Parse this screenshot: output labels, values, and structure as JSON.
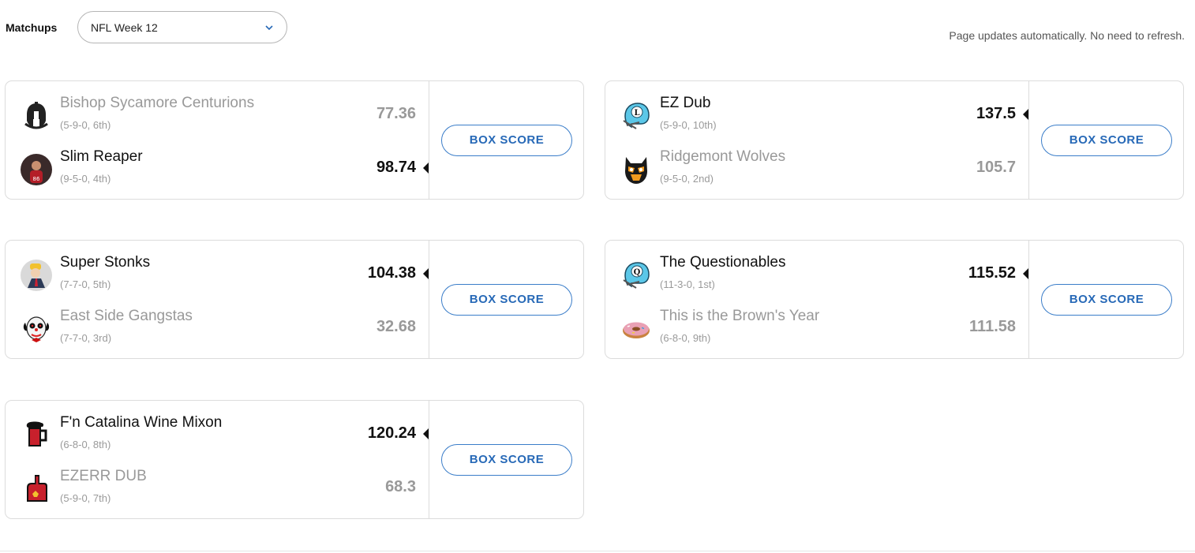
{
  "header": {
    "label": "Matchups",
    "week_select": {
      "value": "NFL Week 12"
    },
    "update_note": "Page updates automatically. No need to refresh."
  },
  "matchups": [
    {
      "box_score_label": "BOX SCORE",
      "teams": [
        {
          "name": "Bishop Sycamore Centurions",
          "record": "(5-9-0, 6th)",
          "score": "77.36",
          "winner": false,
          "icon": "spartan-helmet-icon"
        },
        {
          "name": "Slim Reaper",
          "record": "(9-5-0, 4th)",
          "score": "98.74",
          "winner": true,
          "icon": "player-photo-avatar"
        }
      ]
    },
    {
      "box_score_label": "BOX SCORE",
      "teams": [
        {
          "name": "EZ Dub",
          "record": "(5-9-0, 10th)",
          "score": "137.5",
          "winner": true,
          "icon": "football-helmet-l-icon"
        },
        {
          "name": "Ridgemont Wolves",
          "record": "(9-5-0, 2nd)",
          "score": "105.7",
          "winner": false,
          "icon": "wolf-mask-icon"
        }
      ]
    },
    {
      "box_score_label": "BOX SCORE",
      "teams": [
        {
          "name": "Super Stonks",
          "record": "(7-7-0, 5th)",
          "score": "104.38",
          "winner": true,
          "icon": "stonks-meme-avatar"
        },
        {
          "name": "East Side Gangstas",
          "record": "(7-7-0, 3rd)",
          "score": "32.68",
          "winner": false,
          "icon": "clown-mask-icon"
        }
      ]
    },
    {
      "box_score_label": "BOX SCORE",
      "teams": [
        {
          "name": "The Questionables",
          "record": "(11-3-0, 1st)",
          "score": "115.52",
          "winner": true,
          "icon": "football-helmet-q-icon"
        },
        {
          "name": "This is the Brown's Year",
          "record": "(6-8-0, 9th)",
          "score": "111.58",
          "winner": false,
          "icon": "donut-icon"
        }
      ]
    },
    {
      "box_score_label": "BOX SCORE",
      "teams": [
        {
          "name": "F'n Catalina Wine Mixon",
          "record": "(6-8-0, 8th)",
          "score": "120.24",
          "winner": true,
          "icon": "beer-mug-icon"
        },
        {
          "name": "EZERR DUB",
          "record": "(5-9-0, 7th)",
          "score": "68.3",
          "winner": false,
          "icon": "foam-finger-icon"
        }
      ]
    }
  ],
  "colors": {
    "accent": "#2769b7",
    "winner_text": "#111111",
    "loser_text": "#999999",
    "record_text": "#9a9a9a",
    "border": "#dcdcdc"
  }
}
